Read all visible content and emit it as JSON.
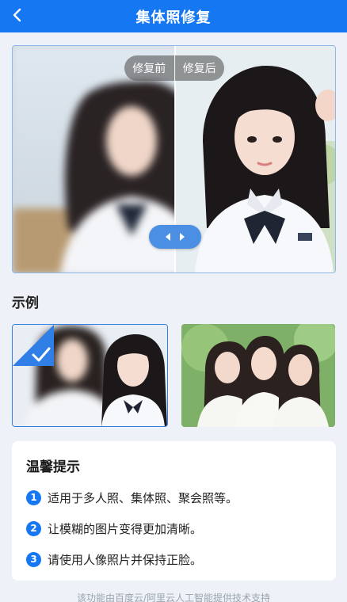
{
  "header": {
    "title": "集体照修复",
    "back_icon": "chevron-left-icon"
  },
  "compare": {
    "before_label": "修复前",
    "after_label": "修复后",
    "handle_icon": "left-right-arrows-icon"
  },
  "examples": {
    "title": "示例",
    "selected_index": 0,
    "check_icon": "checkmark-icon"
  },
  "tips": {
    "title": "温馨提示",
    "items": [
      {
        "num": "1",
        "text": "适用于多人照、集体照、聚会照等。"
      },
      {
        "num": "2",
        "text": "让模糊的图片变得更加清晰。"
      },
      {
        "num": "3",
        "text": "请使用人像照片并保持正脸。"
      }
    ]
  },
  "footer": {
    "note": "该功能由百度云/阿里云人工智能提供技术支持"
  },
  "colors": {
    "primary": "#1677f2",
    "background": "#eef2f8",
    "card": "#ffffff"
  }
}
